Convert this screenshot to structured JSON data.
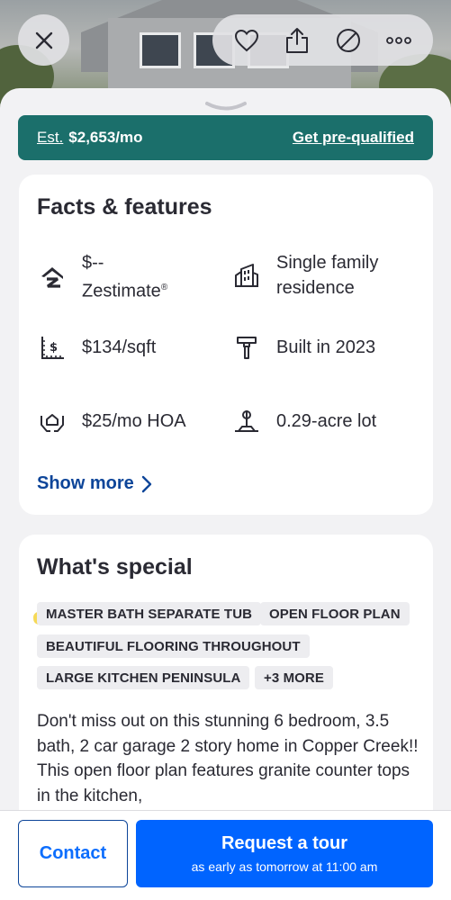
{
  "header": {
    "close_icon": "close-icon",
    "actions": [
      "heart-icon",
      "share-icon",
      "hide-icon",
      "more-icon"
    ]
  },
  "estimate": {
    "label": "Est.",
    "amount": "$2,653/mo",
    "cta": "Get pre-qualified"
  },
  "facts": {
    "title": "Facts & features",
    "items": [
      {
        "icon": "zestimate-icon",
        "line1": "$--",
        "line2": "Zestimate",
        "mark": "®"
      },
      {
        "icon": "building-icon",
        "line1": "Single family",
        "line2": "residence"
      },
      {
        "icon": "price-per-sqft-icon",
        "line1": "$134/sqft"
      },
      {
        "icon": "hammer-icon",
        "line1": "Built in 2023"
      },
      {
        "icon": "hoa-icon",
        "line1": "$25/mo HOA"
      },
      {
        "icon": "lot-icon",
        "line1": "0.29-acre lot"
      }
    ],
    "show_more": "Show more"
  },
  "special": {
    "title": "What's special",
    "tags": [
      "MASTER BATH SEPARATE TUB",
      "OPEN FLOOR PLAN",
      "BEAUTIFUL FLOORING THROUGHOUT",
      "LARGE KITCHEN PENINSULA",
      "+3 MORE"
    ],
    "description": "Don't miss out on this stunning 6 bedroom, 3.5 bath, 2 car garage 2 story home in Copper Creek!!  This open floor plan features granite counter tops in the kitchen,"
  },
  "bottom": {
    "contact": "Contact",
    "tour_title": "Request a tour",
    "tour_sub": "as early as tomorrow at 11:00 am"
  },
  "colors": {
    "estimate_bg": "#1b6f6b",
    "link_blue": "#0d4599",
    "primary_blue": "#0064ff"
  }
}
